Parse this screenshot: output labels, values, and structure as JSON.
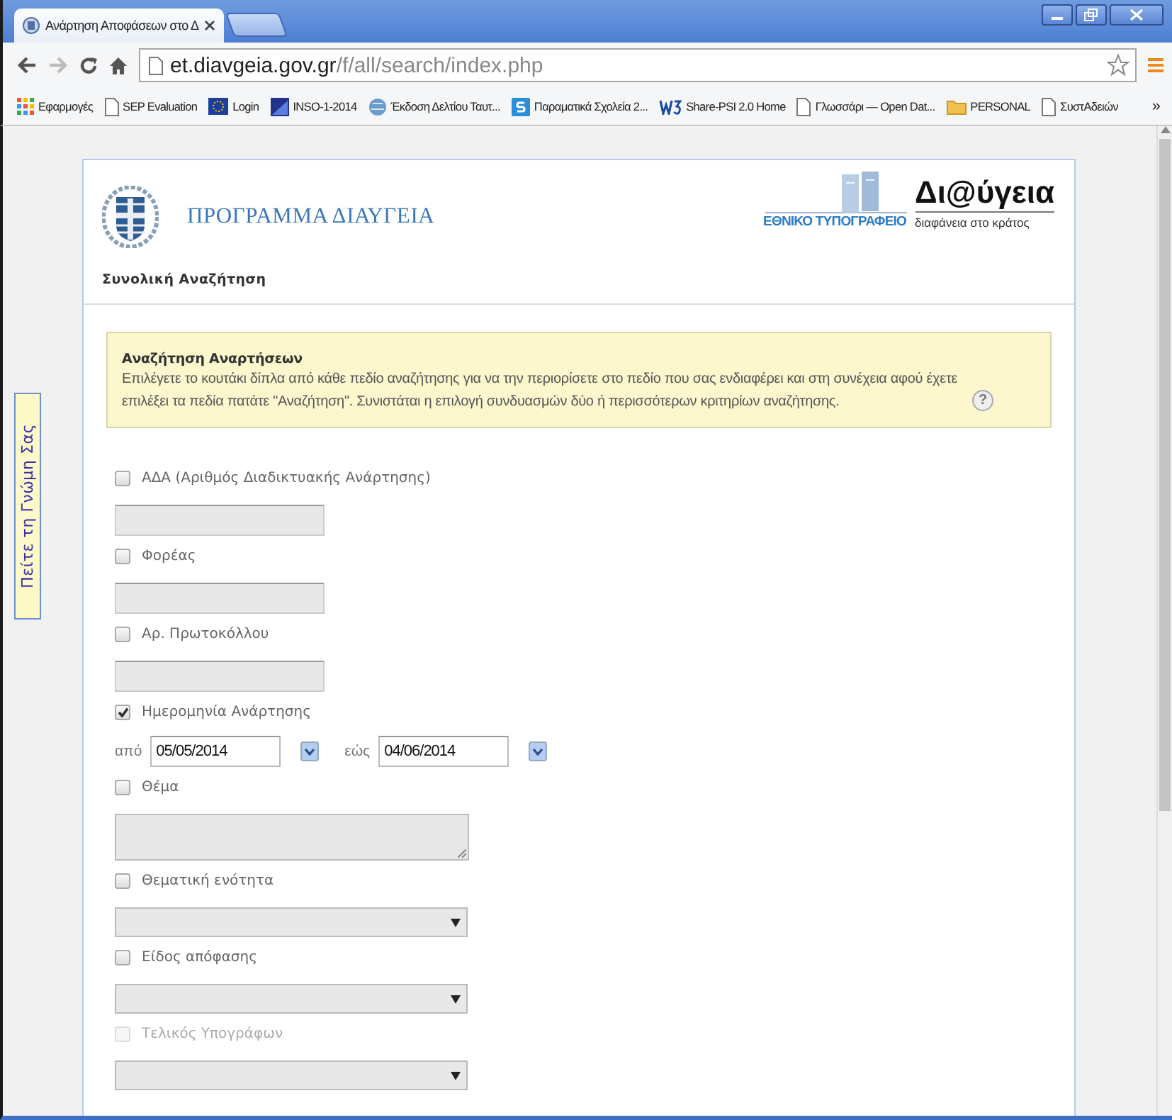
{
  "browser": {
    "tab": {
      "title": "Ανάρτηση Αποφάσεων στο Δ",
      "selected": true
    },
    "address": {
      "host": "et.diavgeia.gov.gr",
      "path": "/f/all/search/index.php"
    },
    "bookmarks": [
      {
        "label": "Εφαρμογές",
        "kind": "apps"
      },
      {
        "label": "SEP Evaluation",
        "kind": "page"
      },
      {
        "label": "Login",
        "kind": "flag"
      },
      {
        "label": "INSO-1-2014",
        "kind": "chart"
      },
      {
        "label": "Έκδοση Δελτίου Ταυτ...",
        "kind": "globe"
      },
      {
        "label": "Παραματικά Σχολεία 2...",
        "kind": "s"
      },
      {
        "label": "Share-PSI 2.0 Home",
        "kind": "w3"
      },
      {
        "label": "Γλωσσάρι — Open Dat...",
        "kind": "page"
      },
      {
        "label": "PERSONAL",
        "kind": "folder"
      },
      {
        "label": "ΣυστΑδειών",
        "kind": "page"
      }
    ],
    "more": "»"
  },
  "feedback_tab": {
    "label": "Πείτε τη Γνώμη Σας"
  },
  "header": {
    "title": "ΠΡΟΓΡΑΜΜΑ ΔΙΑΥΓΕΙΑ",
    "subtitle": "Συνολική Αναζήτηση",
    "logo": {
      "brand": "Δι@ύγεια",
      "publisher": "ΕΘΝΙΚΟ ΤΥΠΟΓΡΑΦΕΙΟ",
      "tagline": "διαφάνεια στο κράτος"
    }
  },
  "notice": {
    "title": "Αναζήτηση Αναρτήσεων",
    "text": "Επιλέγετε το κουτάκι δίπλα από κάθε πεδίο αναζήτησης για να την περιορίσετε στο πεδίο που σας ενδιαφέρει και στη συνέχεια αφού έχετε επιλέξει τα πεδία πατάτε \"Αναζήτηση\". Συνιστάται η επιλογή συνδυασμών δύο ή περισσότερων κριτηρίων αναζήτησης.",
    "help": "?"
  },
  "fields": [
    {
      "kind": "text",
      "label": "ΑΔΑ (Αριθμός Διαδικτυακής Ανάρτησης)",
      "checked": false,
      "disabled": false
    },
    {
      "kind": "text",
      "label": "Φορέας",
      "checked": false,
      "disabled": false
    },
    {
      "kind": "text",
      "label": "Αρ. Πρωτοκόλλου",
      "checked": false,
      "disabled": false
    },
    {
      "kind": "daterange",
      "label": "Ημερομηνία Ανάρτησης",
      "checked": true,
      "disabled": false,
      "from_label": "από",
      "from": "05/05/2014",
      "to_label": "εώς",
      "to": "04/06/2014"
    },
    {
      "kind": "textarea",
      "label": "Θέμα",
      "checked": false,
      "disabled": false
    },
    {
      "kind": "select",
      "label": "Θεματική ενότητα",
      "checked": false,
      "disabled": false
    },
    {
      "kind": "select",
      "label": "Είδος απόφασης",
      "checked": false,
      "disabled": false
    },
    {
      "kind": "select",
      "label": "Τελικός Υπογράφων",
      "checked": false,
      "disabled": true
    }
  ]
}
